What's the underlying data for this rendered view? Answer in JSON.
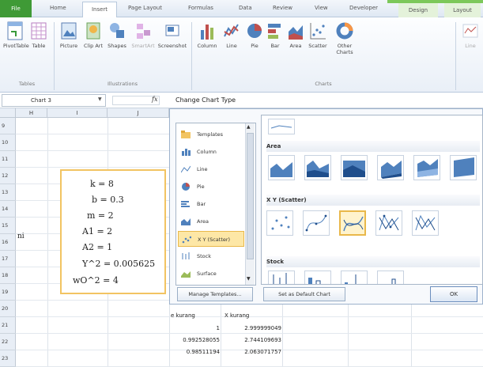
{
  "ribbon_tabs": [
    "File",
    "Home",
    "Insert",
    "Page Layout",
    "Formulas",
    "Data",
    "Review",
    "View",
    "Developer",
    "Design",
    "Layout"
  ],
  "ribbon": {
    "tables": {
      "label": "Tables",
      "buttons": [
        "PivotTable",
        "Table"
      ]
    },
    "illustrations": {
      "label": "Illustrations",
      "buttons": [
        "Picture",
        "Clip Art",
        "Shapes",
        "SmartArt",
        "Screenshot"
      ]
    },
    "charts": {
      "label": "Charts",
      "buttons": [
        "Column",
        "Line",
        "Pie",
        "Bar",
        "Area",
        "Scatter",
        "Other Charts"
      ]
    },
    "extra": [
      "Line"
    ]
  },
  "namebox": "Chart 3",
  "fx": "fx",
  "columns": [
    "H",
    "I",
    "J"
  ],
  "rows": [
    "9",
    "10",
    "11",
    "12",
    "13",
    "14",
    "15",
    "16",
    "17",
    "18",
    "19",
    "20",
    "21",
    "22",
    "23"
  ],
  "row15_cell": "ni",
  "equations": [
    "k = 8",
    "b = 0.3",
    "m = 2",
    "A1 = 2",
    "A2 = 1",
    "Y^2 = 0.005625",
    "wO^2 = 4"
  ],
  "dialog": {
    "title": "Change Chart Type",
    "types": [
      "Templates",
      "Column",
      "Line",
      "Pie",
      "Bar",
      "Area",
      "X Y (Scatter)",
      "Stock",
      "Surface"
    ],
    "selected_type": "X Y (Scatter)",
    "sections": [
      "Area",
      "X Y (Scatter)",
      "Stock"
    ],
    "manage_label": "Manage Templates...",
    "default_label": "Set as Default Chart",
    "ok_label": "OK"
  },
  "table": {
    "headers": [
      "e kurang",
      "X kurang"
    ],
    "rows": [
      [
        "1",
        "2.999999049"
      ],
      [
        "0.992528055",
        "2.744109693"
      ],
      [
        "0.98511194",
        "2.063071757"
      ]
    ]
  },
  "colors": {
    "file_tab": "#3f9a36",
    "design_tab": "#e4f2da",
    "selection": "#e9b84a",
    "chart_border": "#f2c462",
    "chart_blue": "#4f81bd"
  }
}
